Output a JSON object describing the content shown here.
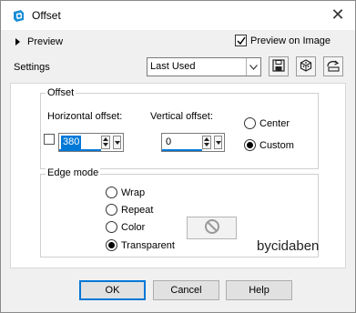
{
  "window": {
    "title": "Offset",
    "close_glyph": "✕"
  },
  "top": {
    "preview_label": "Preview",
    "preview_on_image_label": "Preview on Image",
    "preview_on_image_checked": true,
    "settings_label": "Settings",
    "settings_value": "Last Used"
  },
  "offset": {
    "group_title": "Offset",
    "horizontal_label": "Horizontal offset:",
    "horizontal_value": "380",
    "vertical_label": "Vertical offset:",
    "vertical_value": "0",
    "center_label": "Center",
    "custom_label": "Custom",
    "selected": "custom"
  },
  "edge_mode": {
    "group_title": "Edge mode",
    "options": [
      "Wrap",
      "Repeat",
      "Color",
      "Transparent"
    ],
    "selected": "Transparent"
  },
  "watermark": "bycidaben",
  "buttons": {
    "ok": "OK",
    "cancel": "Cancel",
    "help": "Help"
  },
  "icons": {
    "app": "offset-app-icon",
    "save": "save-preset-icon",
    "reset": "reset-preset-icon",
    "manage": "manage-presets-icon",
    "no_color": "no-color-icon"
  },
  "colors": {
    "accent": "#0078d7",
    "selection": "#0078d7"
  }
}
